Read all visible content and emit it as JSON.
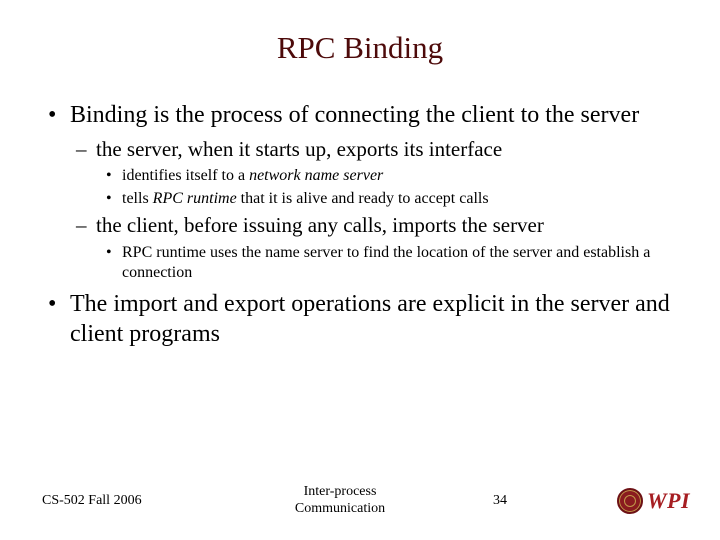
{
  "title": "RPC Binding",
  "bullets": {
    "p1": "Binding is the process of connecting the client to the server",
    "p1a": "the server, when it starts up, exports its interface",
    "p1a_i_pre": "identifies itself to a ",
    "p1a_i_em": "network name server",
    "p1a_ii_pre": "tells ",
    "p1a_ii_em": "RPC runtime",
    "p1a_ii_post": " that it is alive and ready to accept calls",
    "p1b": "the client, before issuing any calls, imports the server",
    "p1b_i": "RPC runtime uses the name server to find the location of the server and establish a connection",
    "p2": "The import and export operations are explicit in the server and client programs"
  },
  "footer": {
    "left": "CS-502 Fall 2006",
    "center_line1": "Inter-process",
    "center_line2": "Communication",
    "page": "34",
    "logo_text": "WPI"
  }
}
